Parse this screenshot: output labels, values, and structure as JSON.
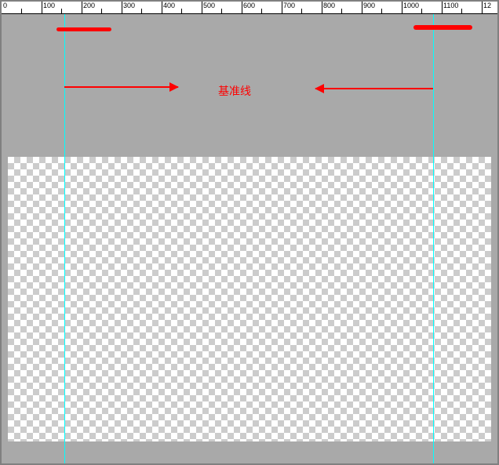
{
  "ruler": {
    "ticks": [
      "0",
      "100",
      "200",
      "300",
      "400",
      "500",
      "600",
      "700",
      "800",
      "900",
      "1000",
      "1100",
      "12"
    ]
  },
  "annotation": {
    "label": "基准线"
  },
  "guides": {
    "left_position": "80",
    "right_position": "550"
  },
  "colors": {
    "canvas_bg": "#a9a9a9",
    "guide": "#00ffff",
    "annotation": "#ff0000"
  }
}
